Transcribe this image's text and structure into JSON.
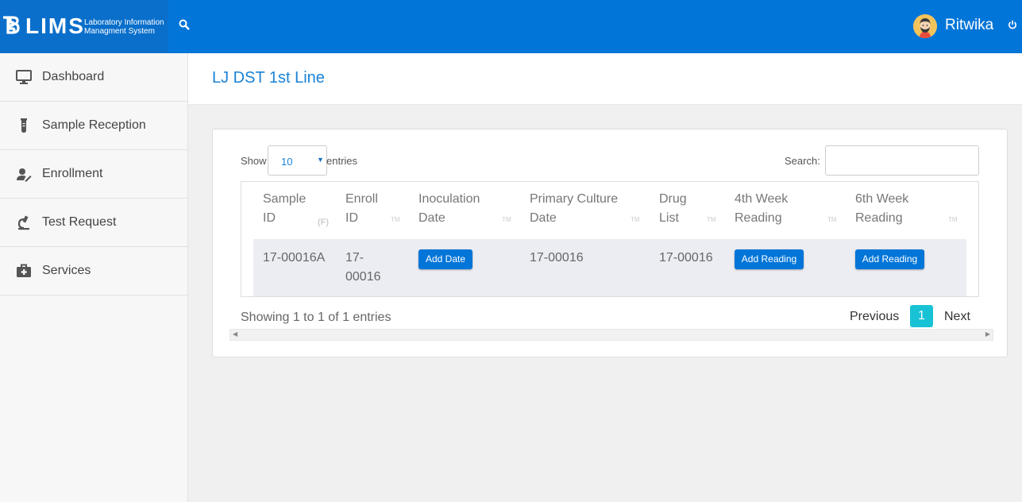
{
  "brand": {
    "name": "LIMS",
    "subtitle_line1": "Laboratory Information",
    "subtitle_line2": "Managment System"
  },
  "header": {
    "user_name": "Ritwika"
  },
  "colors": {
    "primary": "#0275d8",
    "accent": "#17c2d4",
    "sidebar_bg": "#f7f7f7",
    "title": "#1a82d6"
  },
  "sidebar": {
    "items": [
      {
        "label": "Dashboard",
        "icon": "monitor-icon"
      },
      {
        "label": "Sample Reception",
        "icon": "test-tube-icon"
      },
      {
        "label": "Enrollment",
        "icon": "user-edit-icon"
      },
      {
        "label": "Test Request",
        "icon": "microscope-icon"
      },
      {
        "label": "Services",
        "icon": "medical-kit-icon"
      }
    ]
  },
  "page": {
    "title": "LJ DST 1st Line"
  },
  "table": {
    "show_label": "Show",
    "page_length": "10",
    "entries_label": "entries",
    "search_label": "Search:",
    "search_value": "",
    "columns": [
      {
        "line1": "Sample",
        "line2": "ID",
        "sort": "(F)"
      },
      {
        "line1": "Enroll",
        "line2": "ID",
        "sort": "TM"
      },
      {
        "line1": "Inoculation",
        "line2": "Date",
        "sort": "TM"
      },
      {
        "line1": "Primary Culture",
        "line2": "Date",
        "sort": "TM"
      },
      {
        "line1": "Drug",
        "line2": "List",
        "sort": "TM"
      },
      {
        "line1": "4th Week",
        "line2": "Reading",
        "sort": "TM"
      },
      {
        "line1": "6th Week",
        "line2": "Reading",
        "sort": "TM"
      }
    ],
    "rows": [
      {
        "sample_id": "17-00016A",
        "enroll_id_line1": "17-",
        "enroll_id_line2": "00016",
        "inoculation_button": "Add Date",
        "primary_culture_date": "17-00016",
        "drug_list": "17-00016",
        "week4_button": "Add Reading",
        "week6_button": "Add Reading"
      }
    ],
    "info": "Showing 1 to 1 of 1 entries",
    "pagination": {
      "previous": "Previous",
      "current": "1",
      "next": "Next"
    }
  }
}
